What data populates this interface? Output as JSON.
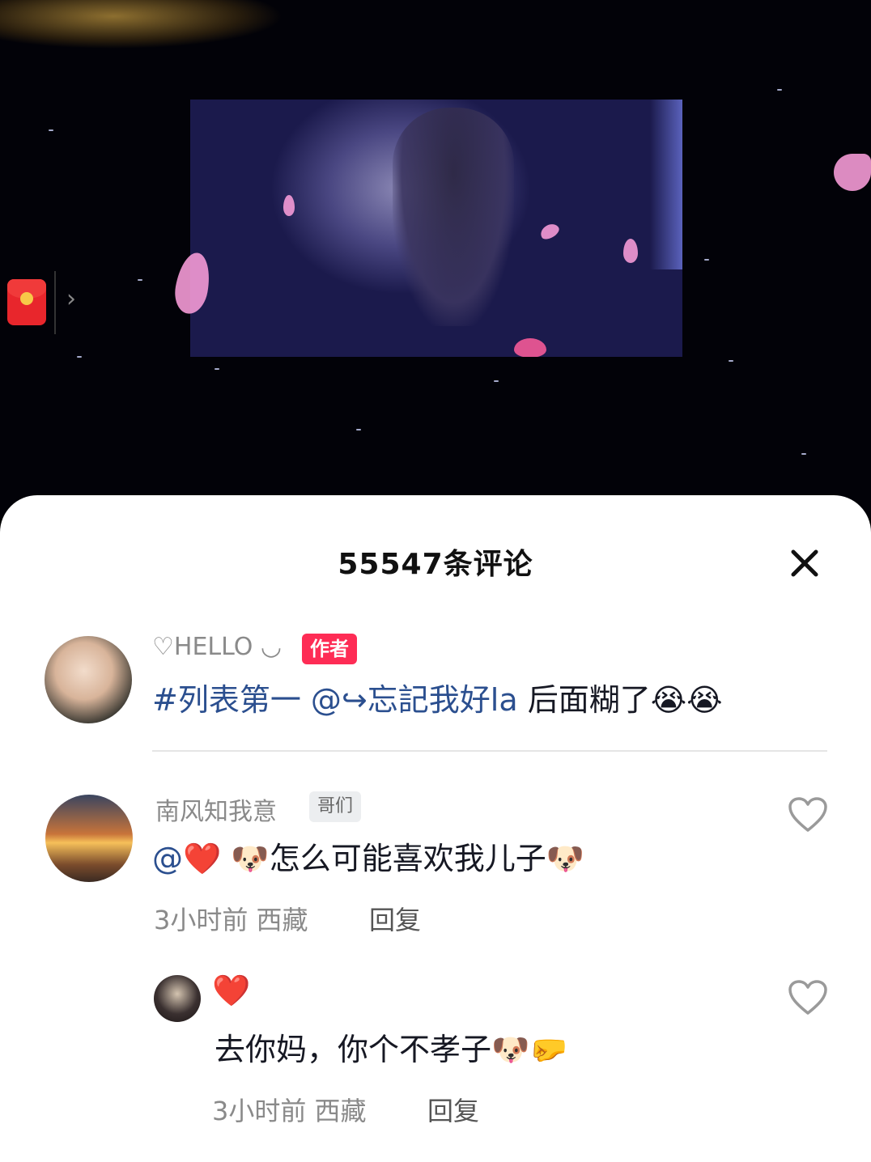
{
  "header": {
    "comment_count_title": "55547条评论",
    "close_icon": "close-icon"
  },
  "comments": [
    {
      "username": "♡HELLO ◡",
      "badge": "作者",
      "text_link": "#列表第一 @↪忘記我好la",
      "text_rest": " 后面糊了",
      "emojis": "😭😭"
    },
    {
      "username": "南风知我意",
      "badge": "哥们",
      "text_prefix": "@",
      "text_heart": "❤️",
      "text_middle": " 🐶怎么可能喜欢我儿子🐶",
      "time": "3小时前",
      "location": "西藏",
      "reply_label": "回复",
      "like_icon": "heart-outline-icon"
    }
  ],
  "replies": [
    {
      "username_emoji": "❤️",
      "text": "去你妈，你个不孝子🐶🤛",
      "time": "3小时前",
      "location": "西藏",
      "reply_label": "回复",
      "like_icon": "heart-outline-icon"
    }
  ],
  "colors": {
    "author_badge": "#fe2c55",
    "link": "#2b4f8f",
    "red_packet": "#e8262c"
  },
  "video": {
    "red_packet_icon": "red-packet-icon",
    "expand_icon": "chevron-right-icon"
  }
}
